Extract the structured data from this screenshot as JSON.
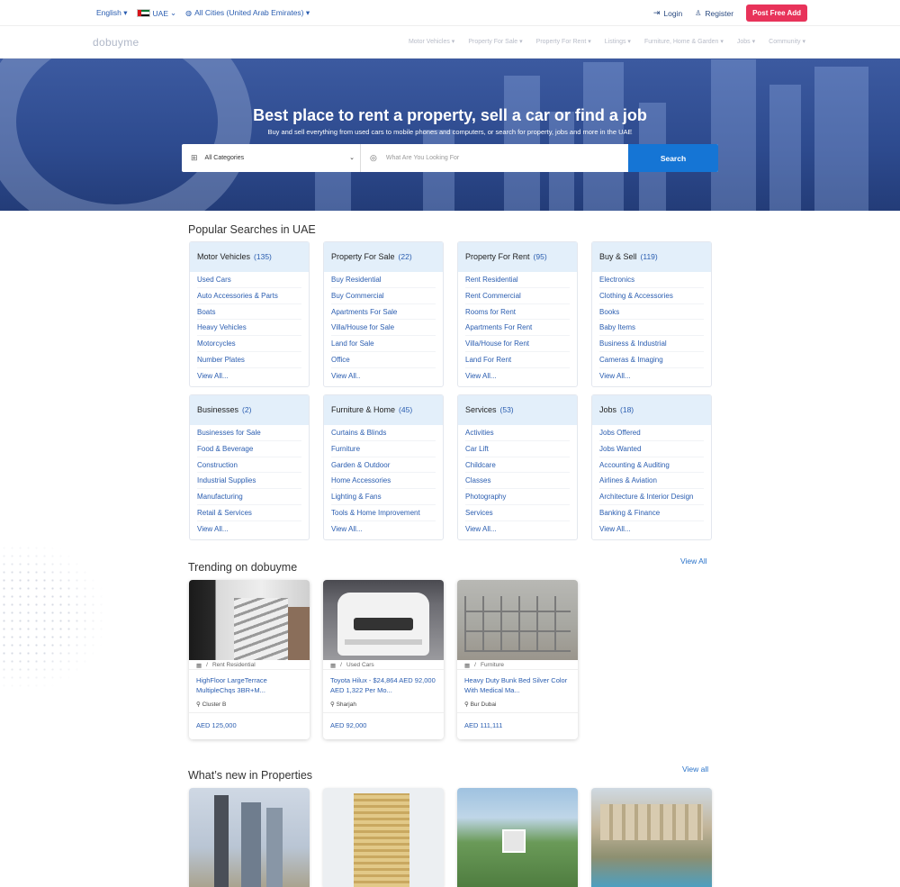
{
  "topbar": {
    "language": "English ▾",
    "country": "UAE",
    "city": "All Cities (United Arab Emirates) ▾",
    "login": "Login",
    "register": "Register",
    "post_btn": "Post Free Add"
  },
  "nav": {
    "logo": "dobuyme",
    "items": [
      "Motor Vehicles ▾",
      "Property For Sale ▾",
      "Property For Rent ▾",
      "Listings ▾",
      "Furniture, Home & Garden ▾",
      "Jobs ▾",
      "Community ▾"
    ]
  },
  "hero": {
    "title": "Best place to rent a property, sell a car or find a job",
    "subtitle": "Buy and sell everything from used cars to mobile phones and computers, or search for property, jobs and more in the UAE",
    "category_select": "All Categories",
    "search_placeholder": "What Are You Looking For",
    "search_btn": "Search"
  },
  "popular": {
    "title": "Popular Searches in UAE",
    "cards": [
      {
        "name": "Motor Vehicles",
        "count": "(135)",
        "links": [
          "Used Cars",
          "Auto Accessories & Parts",
          "Boats",
          "Heavy Vehicles",
          "Motorcycles",
          "Number Plates",
          "View All..."
        ]
      },
      {
        "name": "Property For Sale",
        "count": "(22)",
        "links": [
          "Buy Residential",
          "Buy Commercial",
          "Apartments For Sale",
          "Villa/House for Sale",
          "Land for Sale",
          "Office",
          "View All.."
        ]
      },
      {
        "name": "Property For Rent",
        "count": "(95)",
        "links": [
          "Rent Residential",
          "Rent Commercial",
          "Rooms for Rent",
          "Apartments For Rent",
          "Villa/House for Rent",
          "Land For Rent",
          "View All..."
        ]
      },
      {
        "name": "Buy & Sell",
        "count": "(119)",
        "links": [
          "Electronics",
          "Clothing & Accessories",
          "Books",
          "Baby Items",
          "Business & Industrial",
          "Cameras & Imaging",
          "View All..."
        ]
      },
      {
        "name": "Businesses",
        "count": "(2)",
        "links": [
          "Businesses for Sale",
          "Food & Beverage",
          "Construction",
          "Industrial Supplies",
          "Manufacturing",
          "Retail & Services",
          "View All..."
        ]
      },
      {
        "name": "Furniture & Home",
        "count": "(45)",
        "links": [
          "Curtains & Blinds",
          "Furniture",
          "Garden & Outdoor",
          "Home Accessories",
          "Lighting & Fans",
          "Tools & Home Improvement",
          "View All..."
        ]
      },
      {
        "name": "Services",
        "count": "(53)",
        "links": [
          "Activities",
          "Car Lift",
          "Childcare",
          "Classes",
          "Photography",
          "Services",
          "View All..."
        ]
      },
      {
        "name": "Jobs",
        "count": "(18)",
        "links": [
          "Jobs Offered",
          "Jobs Wanted",
          "Accounting & Auditing",
          "Airlines & Aviation",
          "Architecture & Interior Design",
          "Banking & Finance",
          "View All..."
        ]
      }
    ]
  },
  "trending": {
    "title": "Trending on dobuyme",
    "view_all": "View All",
    "items": [
      {
        "category": "Rent Residential",
        "title": "HighFloor LargeTerrace MultipleChqs 3BR+M...",
        "location": "Cluster B",
        "price": "AED 125,000"
      },
      {
        "category": "Used Cars",
        "title": "Toyota Hilux - $24,864 AED 92,000 AED 1,322 Per Mo...",
        "location": "Sharjah",
        "price": "AED 92,000"
      },
      {
        "category": "Furniture",
        "title": "Heavy Duty Bunk Bed Silver Color With Medical Ma...",
        "location": "Bur Dubai",
        "price": "AED 111,111"
      }
    ]
  },
  "properties": {
    "title": "What’s new in Properties",
    "view_all": "View all"
  },
  "icons": {
    "login": "login-icon",
    "register": "user-icon",
    "location": "location-pin-icon",
    "grid": "grid-icon"
  }
}
